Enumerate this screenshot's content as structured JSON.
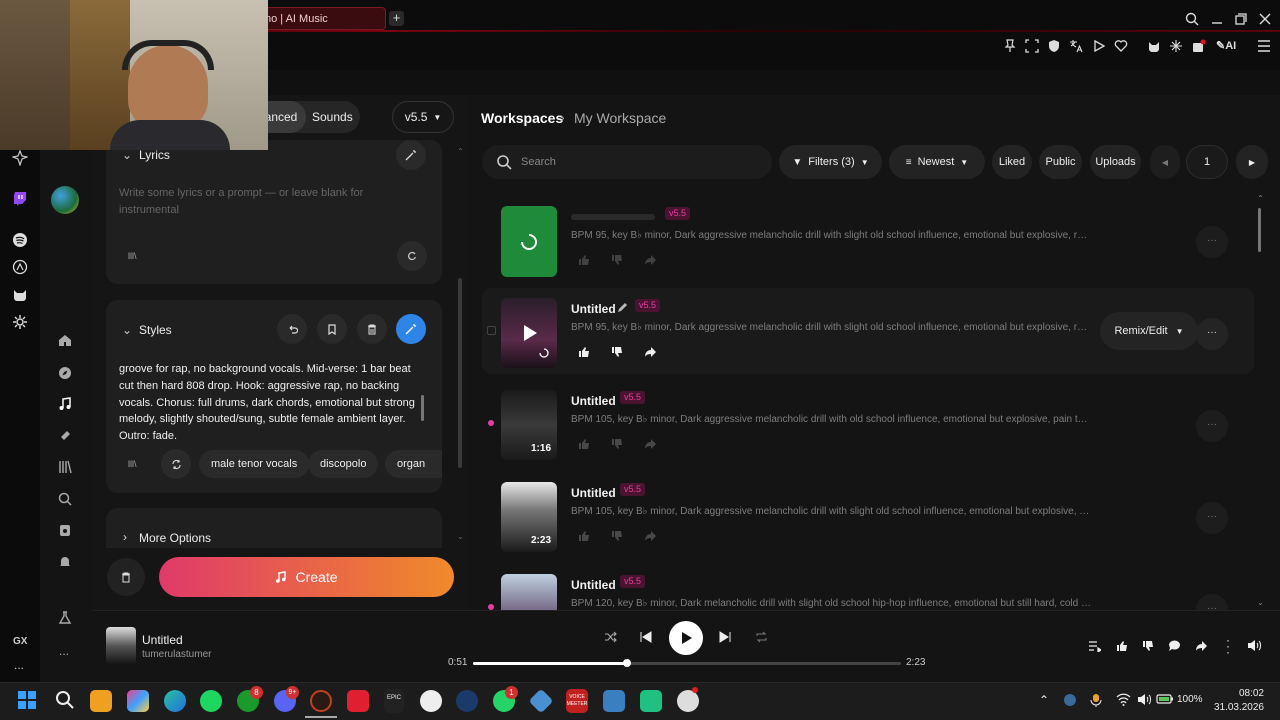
{
  "browser": {
    "tab_title": "no | AI Music",
    "new_tab_label": "+",
    "ext_label": "AI"
  },
  "left": {
    "mode_tabs": [
      "vanced",
      "Sounds"
    ],
    "version": "v5.5",
    "lyrics": {
      "title": "Lyrics",
      "placeholder": "Write some lyrics or a prompt — or leave blank for instrumental",
      "tool_label": "lll\\"
    },
    "styles": {
      "title": "Styles",
      "text": "groove for rap, no background vocals. Mid-verse: 1 bar beat cut then hard 808 drop. Hook: aggressive rap, no backing vocals. Chorus: full drums, dark chords, emotional but strong melody, slightly shouted/sung, subtle female ambient layer. Outro: fade.",
      "tool_label": "lll\\",
      "tags": [
        "male tenor vocals",
        "discopolo",
        "organ"
      ]
    },
    "more_options": "More Options",
    "create_label": "Create"
  },
  "right": {
    "breadcrumb": [
      "Workspaces",
      "My Workspace"
    ],
    "search_placeholder": "Search",
    "filters_label": "Filters (3)",
    "sort_label": "Newest",
    "liked_label": "Liked",
    "public_label": "Public",
    "uploads_label": "Uploads",
    "page_number": "1",
    "remix_label": "Remix/Edit",
    "songs": [
      {
        "title": "",
        "version": "v5.5",
        "description": "BPM 95, key B♭ minor, Dark aggressive melancholic drill with slight old school influence, emotional but explosive, raw an...",
        "duration": "",
        "state": "generating"
      },
      {
        "title": "Untitled",
        "version": "v5.5",
        "description": "BPM 95, key B♭ minor, Dark aggressive melancholic drill with slight old school influence, emotional but explosive, raw an...",
        "duration": "",
        "state": "hover"
      },
      {
        "title": "Untitled",
        "version": "v5.5",
        "description": "BPM 105, key B♭ minor, Dark aggressive melancholic drill with old school influence, emotional but explosive, pain turned i...",
        "duration": "1:16",
        "state": "normal"
      },
      {
        "title": "Untitled",
        "version": "v5.5",
        "description": "BPM 105, key B♭ minor, Dark aggressive melancholic drill with slight old school influence, emotional but explosive, pain turned i...",
        "duration": "2:23",
        "state": "normal"
      },
      {
        "title": "Untitled",
        "version": "v5.5",
        "description": "BPM 120, key B♭ minor, Dark melancholic drill with slight old school hip-hop influence, emotional but still hard, cold and h...",
        "duration": "",
        "state": "normal"
      }
    ]
  },
  "player": {
    "title": "Untitled",
    "artist": "tumerulastumer",
    "elapsed": "0:51",
    "total": "2:23",
    "progress": 0.36
  },
  "sidebar": {
    "gx_label": "GX",
    "more_label": "..."
  },
  "taskbar": {
    "battery": "100%",
    "time": "08:02",
    "date": "31.03.2026",
    "badges": [
      "8",
      "9+",
      "1"
    ],
    "voice_label": "VOICE MEETER",
    "epic_label": "EPIC"
  },
  "colors": {
    "accent": "#e33ea0",
    "create_start": "#e03a6a",
    "create_end": "#f08a2a",
    "brand_red": "#c8101e"
  }
}
